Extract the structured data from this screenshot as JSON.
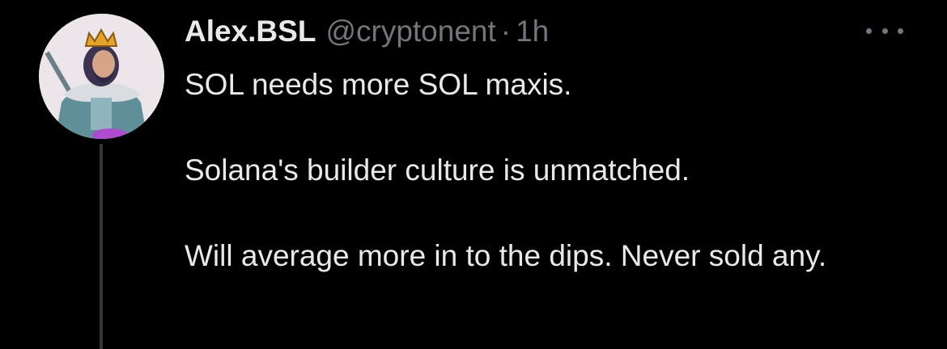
{
  "author": {
    "name": "Alex.BSL",
    "handle": "@cryptonent",
    "separator": "·",
    "time": "1h"
  },
  "menu": {
    "icon": "more-horizontal-icon"
  },
  "avatar": {
    "icon": "king-avatar",
    "background": "#ece6ea"
  },
  "tweet": {
    "paragraphs": [
      "SOL needs more SOL maxis.",
      "Solana's builder culture is unmatched.",
      "Will average more in to the dips. Never sold any."
    ]
  },
  "colors": {
    "background": "#000000",
    "text": "#e7e9ea",
    "secondary": "#71767b",
    "thread_line": "#333639"
  }
}
